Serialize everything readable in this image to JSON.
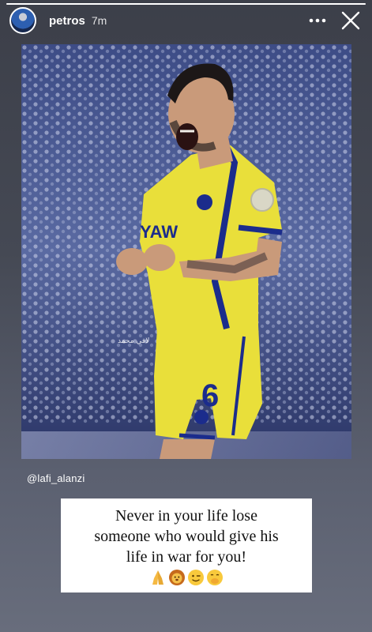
{
  "story": {
    "progress": 1.0
  },
  "header": {
    "username": "petros",
    "time": "7m",
    "more_icon": "more-horizontal-icon",
    "close_icon": "close-icon"
  },
  "post": {
    "image_description_icon": "photo",
    "jersey_number": "6",
    "watermark": "لافي محمد",
    "mention": "@lafi_alanzi"
  },
  "caption": {
    "line1": "Never in your life lose",
    "line2": "someone who would give his",
    "line3": "life in war for you!",
    "emojis": [
      "folded-hands",
      "lion-face",
      "winking-face",
      "hand-over-mouth-face"
    ]
  },
  "colors": {
    "jersey_yellow": "#e9df3a",
    "jersey_blue": "#1b2c8c",
    "stadium_blue": "#4a5a94"
  }
}
